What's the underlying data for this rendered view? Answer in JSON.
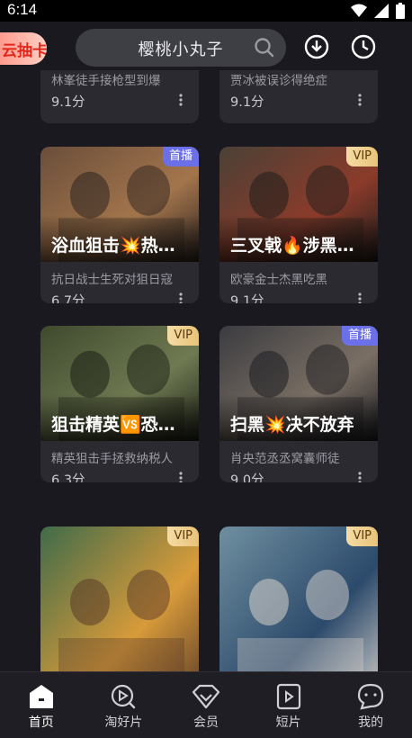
{
  "status_bar": {
    "time": "6:14"
  },
  "header": {
    "promo_badge": "云抽卡",
    "search_query": "樱桃小丸子"
  },
  "partial_row": [
    {
      "desc": "林峯徒手接枪型到爆",
      "score": "9.1分"
    },
    {
      "desc": "贾冰被误诊得绝症",
      "score": "9.1分"
    }
  ],
  "cards": [
    {
      "title": "浴血狙击💥热血开战",
      "desc": "抗日战士生死对狙日寇",
      "score": "6.7分",
      "tag": "首播",
      "tag_type": "first",
      "palette": [
        "#6a4e3a",
        "#a3754c",
        "#2d2420"
      ]
    },
    {
      "title": "三叉戟🔥涉黑风暴",
      "desc": "欧豪金士杰黑吃黑",
      "score": "9.1分",
      "tag": "VIP",
      "tag_type": "vip",
      "palette": [
        "#4a4136",
        "#8b3b2a",
        "#1f1d1b"
      ]
    },
    {
      "title": "狙击精英🆚恐怖分子",
      "desc": "精英狙击手拯救纳税人",
      "score": "6.3分",
      "tag": "VIP",
      "tag_type": "vip",
      "palette": [
        "#3f4a2e",
        "#6f7a52",
        "#1c2015"
      ]
    },
    {
      "title": "扫黑💥决不放弃",
      "desc": "肖央范丞丞窝囊师徒",
      "score": "9.0分",
      "tag": "首播",
      "tag_type": "first",
      "palette": [
        "#3b3b40",
        "#7a6f64",
        "#1d1d22"
      ]
    },
    {
      "title": "",
      "desc": "",
      "score": "",
      "tag": "VIP",
      "tag_type": "vip",
      "palette": [
        "#3f6b4a",
        "#d89b3a",
        "#5a3a28"
      ]
    },
    {
      "title": "",
      "desc": "",
      "score": "",
      "tag": "VIP",
      "tag_type": "vip",
      "palette": [
        "#6f8fa0",
        "#2c4a6b",
        "#d7d2cb"
      ]
    }
  ],
  "tabs": [
    {
      "label": "首页",
      "icon": "home-icon",
      "active": true
    },
    {
      "label": "淘好片",
      "icon": "discover-play-icon",
      "active": false
    },
    {
      "label": "会员",
      "icon": "vip-diamond-icon",
      "active": false
    },
    {
      "label": "短片",
      "icon": "short-video-icon",
      "active": false
    },
    {
      "label": "我的",
      "icon": "profile-chat-icon",
      "active": false
    }
  ],
  "colors": {
    "background": "#1a191f",
    "card": "#2b2a31",
    "vip_tag": "#e8c379",
    "first_tag": "#6b6fe8"
  }
}
